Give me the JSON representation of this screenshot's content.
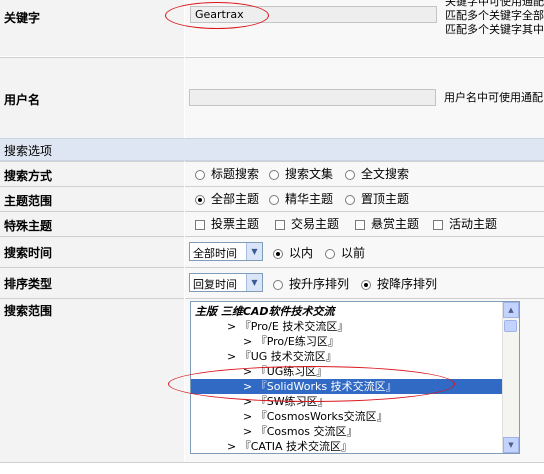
{
  "keyword": {
    "label": "关键字",
    "value": "Geartrax",
    "hints": [
      "关键字中可使用通配",
      "匹配多个关键字全部",
      "匹配多个关键字其中"
    ]
  },
  "username": {
    "label": "用户名",
    "value": "",
    "hint": "用户名中可使用通配"
  },
  "section_title": "搜索选项",
  "search_method": {
    "label": "搜索方式",
    "options": [
      "标题搜索",
      "搜索文集",
      "全文搜索"
    ],
    "selected": "none"
  },
  "topic_scope": {
    "label": "主题范围",
    "options": [
      "全部主题",
      "精华主题",
      "置顶主题"
    ],
    "selected": "全部主题"
  },
  "special_topics": {
    "label": "特殊主题",
    "options": [
      "投票主题",
      "交易主题",
      "悬赏主题",
      "活动主题"
    ]
  },
  "search_time": {
    "label": "搜索时间",
    "select_value": "全部时间",
    "options": [
      "以内",
      "以前"
    ],
    "selected": "以内"
  },
  "sort_type": {
    "label": "排序类型",
    "select_value": "回复时间",
    "options": [
      "按升序排列",
      "按降序排列"
    ],
    "selected": "按降序排列"
  },
  "search_scope": {
    "label": "搜索范围",
    "items": [
      {
        "text": "主版 三维CAD软件技术交流",
        "level": 0,
        "bold": true
      },
      {
        "text": ">  『Pro/E 技术交流区』",
        "level": 1
      },
      {
        "text": ">  『Pro/E练习区』",
        "level": 2
      },
      {
        "text": ">  『UG 技术交流区』",
        "level": 1
      },
      {
        "text": ">  『UG练习区』",
        "level": 2
      },
      {
        "text": ">  『SolidWorks 技术交流区』",
        "level": 2,
        "selected": true
      },
      {
        "text": ">  『SW练习区』",
        "level": 2
      },
      {
        "text": ">  『CosmosWorks交流区』",
        "level": 2
      },
      {
        "text": ">  『Cosmos 交流区』",
        "level": 2
      },
      {
        "text": ">  『CATIA 技术交流区』",
        "level": 1
      }
    ]
  },
  "colors": {
    "label_bg": "#f3f3f3",
    "section_bg": "#dde6f2",
    "selection": "#316ac5",
    "annotation": "#d9141a"
  }
}
